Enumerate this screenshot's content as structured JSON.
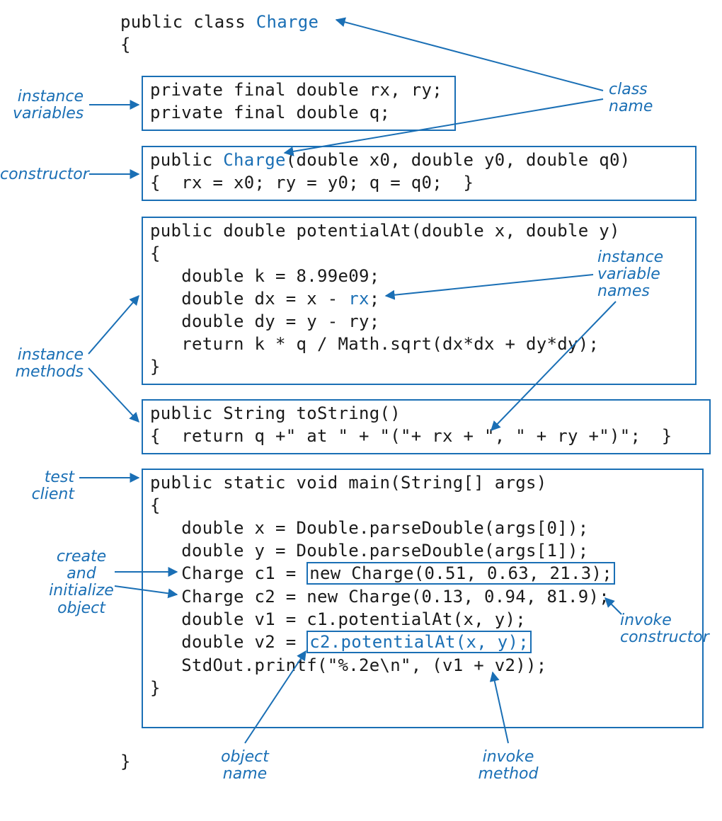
{
  "labels": {
    "instance_variables": "instance\nvariables",
    "constructor": "constructor",
    "instance_methods": "instance\nmethods",
    "test_client": "test client",
    "create_obj": "create\nand\ninitialize\nobject",
    "class_name": "class\nname",
    "ivar_names": "instance\nvariable\nnames",
    "invoke_ctor": "invoke\nconstructor",
    "object_name": "object\nname",
    "invoke_method": "invoke\nmethod"
  },
  "code": {
    "class_decl_pre": "public class ",
    "class_decl_name": "Charge",
    "open_brace": "{",
    "ivar_l1": "private final double rx, ry;",
    "ivar_l2": "private final double q;",
    "ctor_sig_pre": "public ",
    "ctor_sig_name": "Charge",
    "ctor_sig_post": "(double x0, double y0, double q0)",
    "ctor_body": "{  rx = x0; ry = y0; q = q0;  }",
    "m1_l1": "public double potentialAt(double x, double y)",
    "m1_l2": "{",
    "m1_l3": "   double k = 8.99e09;",
    "m1_l4a": "   double dx = x - ",
    "m1_l4b": "rx",
    "m1_l4c": ";",
    "m1_l5": "   double dy = y - ry;",
    "m1_l6": "   return k * q / Math.sqrt(dx*dx + dy*dy);",
    "m1_l7": "}",
    "m2_l1": "public String toString()",
    "m2_l2": "{  return q +\" at \" + \"(\"+ rx + \", \" + ry +\")\";  }",
    "main_l1": "public static void main(String[] args)",
    "main_l2": "{",
    "main_l3": "   double x = Double.parseDouble(args[0]);",
    "main_l4": "   double y = Double.parseDouble(args[1]);",
    "main_l5a": "   Charge c1 = ",
    "main_l5b": "new Charge(0.51, 0.63, 21.3);",
    "main_l6": "   Charge c2 = new Charge(0.13, 0.94, 81.9);",
    "main_l7": "   double v1 = c1.potentialAt(x, y);",
    "main_l8a": "   double v2 = ",
    "main_l8b": "c2.potentialAt(x, y);",
    "main_l9": "   StdOut.printf(\"%.2e\\n\", (v1 + v2));",
    "main_l10": "}",
    "close_brace": "}"
  }
}
